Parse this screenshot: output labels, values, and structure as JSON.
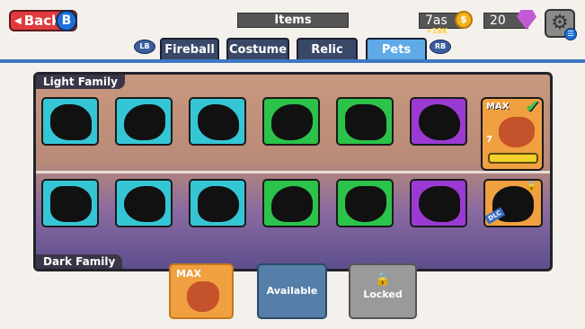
{
  "header": {
    "back_label": "Back",
    "back_badge": "B",
    "title": "Items",
    "coins": "7as",
    "coin_plus": "+18K",
    "gems": "20"
  },
  "tabs": [
    {
      "label": "Fireball",
      "active": false
    },
    {
      "label": "Costume",
      "active": false
    },
    {
      "label": "Relic",
      "active": false
    },
    {
      "label": "Pets",
      "active": true
    }
  ],
  "tab_buttons": {
    "left": "LB",
    "right": "RB"
  },
  "families": {
    "light": {
      "label": "Light Family",
      "slots": [
        "cyan",
        "cyan",
        "cyan",
        "green",
        "green",
        "purple"
      ],
      "featured": {
        "badge": "MAX",
        "level": "7",
        "owned": true
      }
    },
    "dark": {
      "label": "Dark Family",
      "slots": [
        "cyan",
        "cyan",
        "cyan",
        "green",
        "green",
        "purple"
      ],
      "dlc": {
        "tag": "DLC",
        "locked": true
      }
    }
  },
  "legend": {
    "max_label": "MAX",
    "available_label": "Available",
    "locked_label": "Locked"
  },
  "colors": {
    "cyan": "#35c6d6",
    "green": "#2cc34a",
    "purple": "#9b3ad3",
    "orange": "#f0a040",
    "active_tab": "#5ea9e6"
  }
}
